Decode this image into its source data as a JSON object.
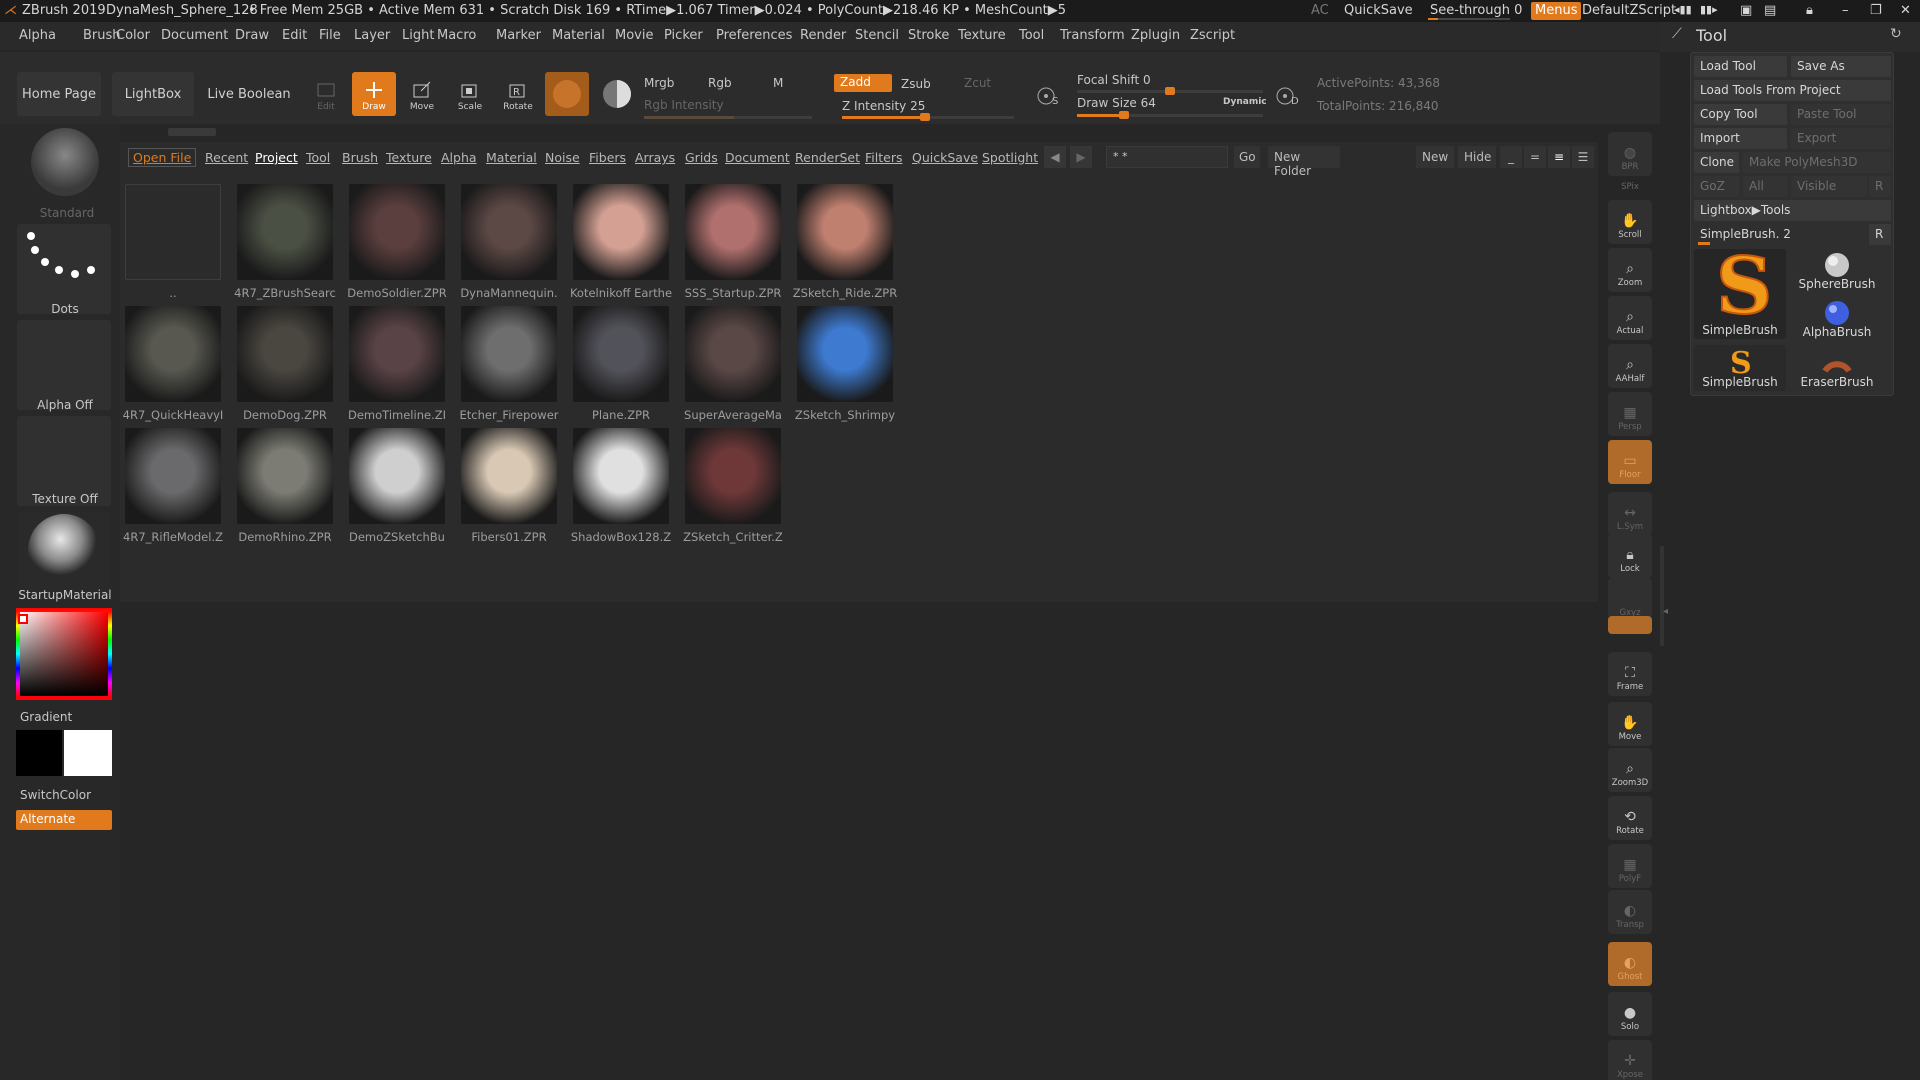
{
  "titlebar": {
    "app": "ZBrush 2019",
    "doc": "DynaMesh_Sphere_128",
    "stats": "• Free Mem 25GB • Active Mem 631 • Scratch Disk 169 • RTime▶1.067 Timer▶0.024 • PolyCount▶218.46 KP • MeshCount▶5",
    "ac": "AC",
    "quicksave": "QuickSave",
    "seethrough": "See-through",
    "seethrough_value": "0",
    "menus": "Menus",
    "zscript": "DefaultZScript"
  },
  "menubar": [
    "Alpha",
    "Brush",
    "Color",
    "Document",
    "Draw",
    "Edit",
    "File",
    "Layer",
    "Light",
    "Macro",
    "Marker",
    "Material",
    "Movie",
    "Picker",
    "Preferences",
    "Render",
    "Stencil",
    "Stroke",
    "Texture",
    "Tool",
    "Transform",
    "Zplugin",
    "Zscript"
  ],
  "shelf": {
    "home": "Home Page",
    "lightbox": "LightBox",
    "liveboolean": "Live Boolean",
    "edit": "Edit",
    "draw": "Draw",
    "move": "Move",
    "scale": "Scale",
    "rotate": "Rotate",
    "mrgb": "Mrgb",
    "rgb": "Rgb",
    "m": "M",
    "rgb_intensity": "Rgb Intensity",
    "zadd": "Zadd",
    "zsub": "Zsub",
    "zcut": "Zcut",
    "z_intensity": "Z Intensity 25",
    "focal_shift": "Focal Shift 0",
    "draw_size": "Draw Size 64",
    "dynamic": "Dynamic",
    "active_points": "ActivePoints: 43,368",
    "total_points": "TotalPoints: 216,840",
    "s_label": "S",
    "d_label": "D"
  },
  "lefttray": {
    "standard": "Standard",
    "dots": "Dots",
    "alpha": "Alpha Off",
    "texture": "Texture Off",
    "material": "StartupMaterial",
    "gradient": "Gradient",
    "switchcolor": "SwitchColor",
    "alternate": "Alternate"
  },
  "lightbox": {
    "tabs": [
      "Open File",
      "Recent",
      "Project",
      "Tool",
      "Brush",
      "Texture",
      "Alpha",
      "Material",
      "Noise",
      "Fibers",
      "Arrays",
      "Grids",
      "Document",
      "RenderSet",
      "Filters",
      "QuickSave",
      "Spotlight"
    ],
    "search_value": "* *",
    "go": "Go",
    "new_folder": "New Folder",
    "new": "New",
    "hide": "Hide",
    "folder_label": "..",
    "files": [
      [
        "4R7_ZBrushSearc",
        "DemoSoldier.ZPR",
        "DynaMannequin.",
        "Kotelnikoff Earthe",
        "SSS_Startup.ZPR",
        "ZSketch_Ride.ZPR"
      ],
      [
        "4R7_QuickHeavyI",
        "DemoDog.ZPR",
        "DemoTimeline.ZI",
        "Etcher_Firepower",
        "Plane.ZPR",
        "SuperAverageMa",
        "ZSketch_Shrimpy"
      ],
      [
        "4R7_RifleModel.Z",
        "DemoRhino.ZPR",
        "DemoZSketchBu",
        "Fibers01.ZPR",
        "ShadowBox128.Z",
        "ZSketch_Critter.Z"
      ]
    ]
  },
  "rtools": [
    "BPR",
    "SPix",
    "Scroll",
    "Zoom",
    "Actual",
    "AAHalf",
    "Persp",
    "Floor",
    "L.Sym",
    "Lock",
    "Gxyz",
    "",
    "",
    "Frame",
    "Move",
    "Zoom3D",
    "Rotate",
    "PolyF",
    "Transp",
    "Ghost",
    "Solo",
    "Xpose"
  ],
  "tool": {
    "title": "Tool",
    "load_tool": "Load Tool",
    "save_as": "Save As",
    "load_from_project": "Load Tools From Project",
    "copy_tool": "Copy Tool",
    "paste_tool": "Paste Tool",
    "import": "Import",
    "export": "Export",
    "clone": "Clone",
    "make_polymesh": "Make PolyMesh3D",
    "goz": "GoZ",
    "all": "All",
    "visible": "Visible",
    "r": "R",
    "lightbox_tools": "Lightbox▶Tools",
    "current_tool": "SimpleBrush. 2",
    "r2": "R",
    "brushes": [
      "SimpleBrush",
      "SphereBrush",
      "AlphaBrush",
      "SimpleBrush",
      "EraserBrush"
    ]
  },
  "colors": {
    "accent": "#e07a1c",
    "bg": "#262626"
  }
}
